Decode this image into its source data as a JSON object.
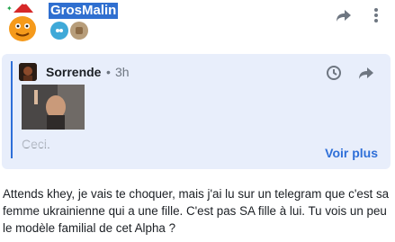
{
  "post": {
    "username": "GrosMalin",
    "badges": [
      "ice-badge-icon",
      "beige-badge-icon"
    ],
    "message": "Attends khey, je vais te choquer, mais j'ai lu sur un telegram que c'est sa femme ukrainienne qui a une fille. C'est pas SA fille à lui. Tu vois un peu le modèle familial de cet Alpha ?"
  },
  "quote": {
    "author": "Sorrende",
    "separator": "•",
    "time": "3h",
    "text": "Ceci.",
    "see_more": "Voir plus"
  },
  "colors": {
    "accent": "#2e6fd8",
    "quote_bg": "#e8eefb",
    "username_highlight": "#2f6fd0"
  }
}
